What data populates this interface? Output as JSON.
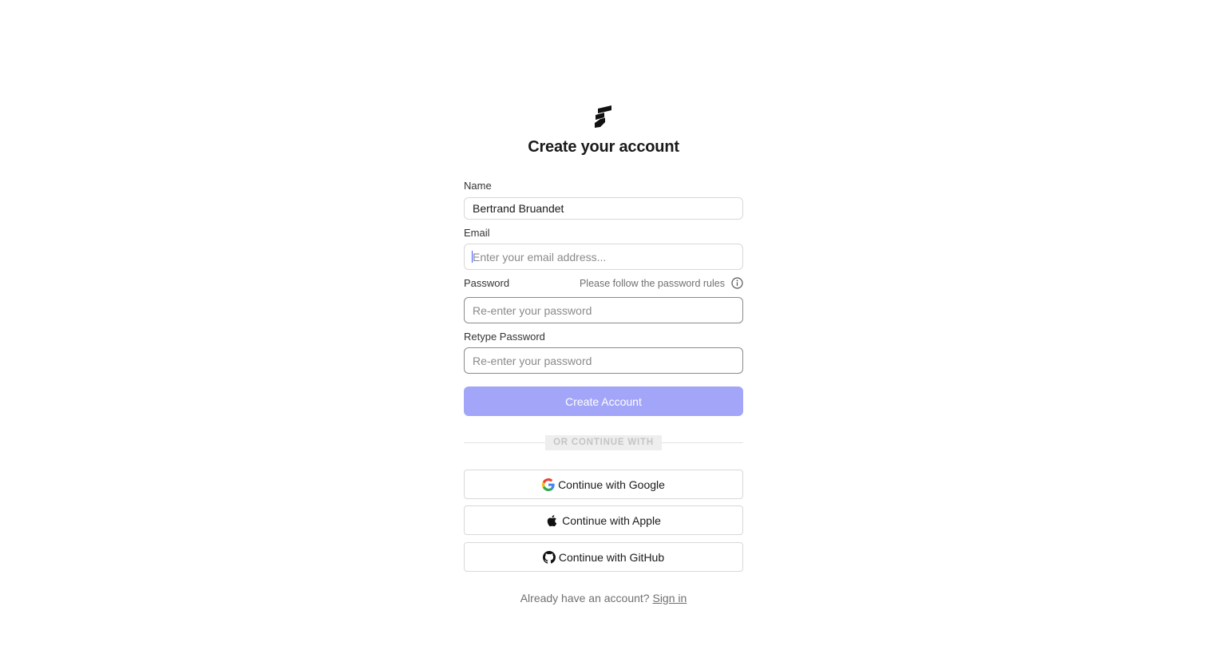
{
  "header": {
    "logo_icon": "brand-logo-icon",
    "title": "Create your account"
  },
  "form": {
    "name": {
      "label": "Name",
      "value": "Bertrand Bruandet"
    },
    "email": {
      "label": "Email",
      "placeholder": "Enter your email address..."
    },
    "password": {
      "label": "Password",
      "hint": "Please follow the password rules",
      "hint_icon": "info-icon",
      "placeholder": "Re-enter your password"
    },
    "retype_password": {
      "label": "Retype Password",
      "placeholder": "Re-enter your password"
    },
    "submit_label": "Create Account",
    "submit_color": "#a3a6f8"
  },
  "divider": {
    "label": "OR CONTINUE WITH"
  },
  "social": [
    {
      "label": "Continue with Google",
      "icon": "google-icon"
    },
    {
      "label": "Continue with Apple",
      "icon": "apple-icon"
    },
    {
      "label": "Continue with GitHub",
      "icon": "github-icon"
    }
  ],
  "footer": {
    "prompt": "Already have an account?",
    "link": "Sign in"
  }
}
